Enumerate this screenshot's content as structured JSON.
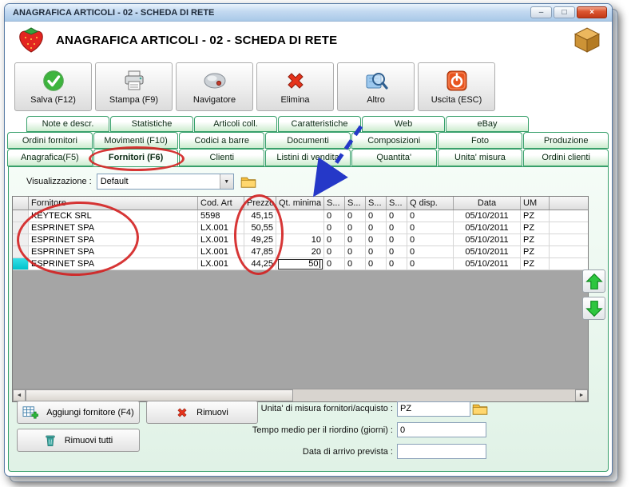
{
  "window": {
    "title": "ANAGRAFICA ARTICOLI - 02 - SCHEDA DI RETE"
  },
  "header": {
    "title": "ANAGRAFICA ARTICOLI - 02 - SCHEDA DI RETE"
  },
  "icons": {
    "minimize": "–",
    "maximize": "□",
    "close": "×",
    "dropdown_arrow": "▼",
    "scroll_left": "◄",
    "scroll_right": "►"
  },
  "toolbar": [
    {
      "label": "Salva (F12)",
      "icon": "save-check-icon"
    },
    {
      "label": "Stampa (F9)",
      "icon": "printer-icon"
    },
    {
      "label": "Navigatore",
      "icon": "navigator-icon"
    },
    {
      "label": "Elimina",
      "icon": "delete-x-icon"
    },
    {
      "label": "Altro",
      "icon": "magnifier-icon"
    },
    {
      "label": "Uscita (ESC)",
      "icon": "power-icon"
    }
  ],
  "tabs": {
    "row1": [
      "Note e descr.",
      "Statistiche",
      "Articoli coll.",
      "Caratteristiche",
      "Web",
      "eBay"
    ],
    "row2": [
      "Ordini fornitori",
      "Movimenti (F10)",
      "Codici a barre",
      "Documenti",
      "Composizioni",
      "Foto",
      "Produzione"
    ],
    "row3": [
      "Anagrafica(F5)",
      "Fornitori (F6)",
      "Clienti",
      "Listini di vendita",
      "Quantita'",
      "Unita' misura",
      "Ordini clienti"
    ],
    "active_tab": "Fornitori (F6)"
  },
  "view_selector": {
    "label": "Visualizzazione :",
    "value": "Default"
  },
  "grid": {
    "columns": [
      "Fornitore",
      "Cod. Art",
      "Prezzo",
      "Qt. minima ...",
      "S...",
      "S...",
      "S...",
      "S...",
      "Q disp.",
      "Data",
      "UM"
    ],
    "rows": [
      [
        "KEYTECK SRL",
        "5598",
        "45,15",
        "",
        "0",
        "0",
        "0",
        "0",
        "0",
        "05/10/2011",
        "PZ"
      ],
      [
        "ESPRINET SPA",
        "LX.001",
        "50,55",
        "",
        "0",
        "0",
        "0",
        "0",
        "0",
        "05/10/2011",
        "PZ"
      ],
      [
        "ESPRINET SPA",
        "LX.001",
        "49,25",
        "10",
        "0",
        "0",
        "0",
        "0",
        "0",
        "05/10/2011",
        "PZ"
      ],
      [
        "ESPRINET SPA",
        "LX.001",
        "47,85",
        "20",
        "0",
        "0",
        "0",
        "0",
        "0",
        "05/10/2011",
        "PZ"
      ],
      [
        "ESPRINET SPA",
        "LX.001",
        "44,25",
        "50",
        "0",
        "0",
        "0",
        "0",
        "0",
        "05/10/2011",
        "PZ"
      ]
    ],
    "editing_cell": {
      "row_index": 4,
      "column": "Qt. minima",
      "value": "50"
    }
  },
  "actions": {
    "add_supplier": "Aggiungi fornitore (F4)",
    "remove": "Rimuovi",
    "remove_all": "Rimuovi tutti"
  },
  "fields": {
    "unit_label": "Unita' di misura fornitori/acquisto :",
    "unit_value": "PZ",
    "reorder_label": "Tempo medio per il riordino (giorni) :",
    "reorder_value": "0",
    "arrival_label": "Data di arrivo prevista :",
    "arrival_value": ""
  },
  "annotation_colors": {
    "circle": "#d32020",
    "arrow": "#2538c8"
  }
}
